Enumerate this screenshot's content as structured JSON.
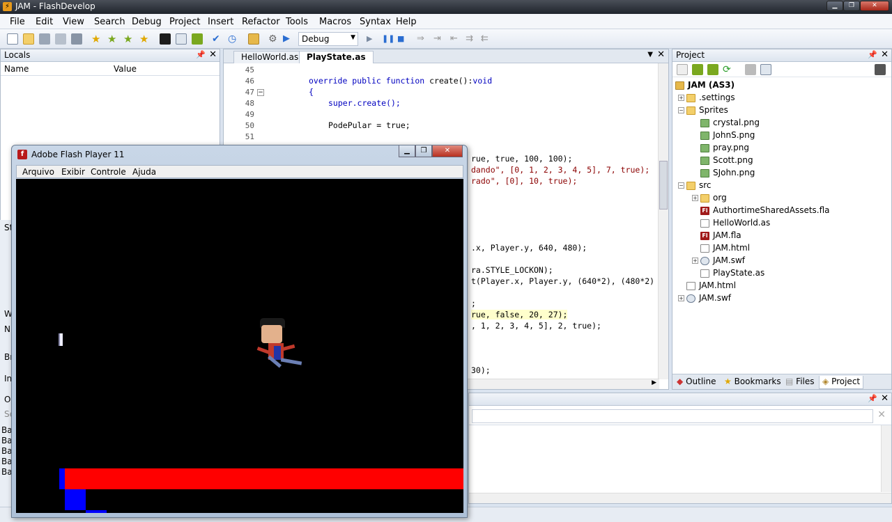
{
  "window": {
    "title": "JAM - FlashDevelop",
    "app_icon": "flashdevelop-icon"
  },
  "menu": [
    "File",
    "Edit",
    "View",
    "Search",
    "Debug",
    "Project",
    "Insert",
    "Refactor",
    "Tools",
    "Macros",
    "Syntax",
    "Help"
  ],
  "toolbar": {
    "config_value": "Debug"
  },
  "locals": {
    "title": "Locals",
    "col_name": "Name",
    "col_value": "Value"
  },
  "side_fragments": [
    "St",
    "W",
    "N",
    "Br",
    "In",
    "O"
  ],
  "editor": {
    "tabs": [
      "HelloWorld.as",
      "PlayState.as"
    ],
    "active_tab": "PlayState.as",
    "line_numbers": [
      "45",
      "46",
      "47",
      "48",
      "49",
      "50",
      "51"
    ],
    "lines": {
      "l46_kw": "override public function",
      "l46_rest": " create():",
      "l46_type": "void",
      "l47": "{",
      "l48": "super.create();",
      "l50": "PodePular = true;",
      "r1": "rue, true, 100, 100);",
      "r2": "dando\", [0, 1, 2, 3, 4, 5], 7, true);",
      "r3": "rado\", [0], 10, true);",
      "r4": ".x, Player.y, 640, 480);",
      "r5": "ra.STYLE_LOCKON);",
      "r6": "t(Player.x, Player.y, (640*2), (480*2)",
      "r7": ";",
      "r8": "rue, false, 20, 27);",
      "r9": ", 1, 2, 3, 4, 5], 2, true);",
      "r10": "30);"
    }
  },
  "project": {
    "title": "Project",
    "root": "JAM (AS3)",
    "items": [
      {
        "label": ".settings",
        "type": "folder",
        "indent": 1
      },
      {
        "label": "Sprites",
        "type": "folder",
        "indent": 1
      },
      {
        "label": "crystal.png",
        "type": "img",
        "indent": 2
      },
      {
        "label": "JohnS.png",
        "type": "img",
        "indent": 2
      },
      {
        "label": "pray.png",
        "type": "img",
        "indent": 2
      },
      {
        "label": "Scott.png",
        "type": "img",
        "indent": 2
      },
      {
        "label": "SJohn.png",
        "type": "img",
        "indent": 2
      },
      {
        "label": "src",
        "type": "folder",
        "indent": 1
      },
      {
        "label": "org",
        "type": "folder",
        "indent": 2
      },
      {
        "label": "AuthortimeSharedAssets.fla",
        "type": "fla",
        "indent": 2
      },
      {
        "label": "HelloWorld.as",
        "type": "as",
        "indent": 2
      },
      {
        "label": "JAM.fla",
        "type": "fla",
        "indent": 2
      },
      {
        "label": "JAM.html",
        "type": "as",
        "indent": 2
      },
      {
        "label": "JAM.swf",
        "type": "swf",
        "indent": 2
      },
      {
        "label": "PlayState.as",
        "type": "as",
        "indent": 2
      },
      {
        "label": "JAM.html",
        "type": "as",
        "indent": 1
      },
      {
        "label": "JAM.swf",
        "type": "swf",
        "indent": 1
      }
    ],
    "bottom_tabs": [
      "Outline",
      "Bookmarks",
      "Files",
      "Project"
    ],
    "active_bottom_tab": "Project"
  },
  "output": {
    "fragments": [
      "Ba",
      "Ba",
      "Ba",
      "Ba",
      "Ba"
    ],
    "search_prefix": "Se"
  },
  "flash": {
    "title": "Adobe Flash Player 11",
    "menu": [
      "Arquivo",
      "Exibir",
      "Controle",
      "Ajuda"
    ]
  },
  "colors": {
    "platform": "#ff0000",
    "block": "#0000ff",
    "stage": "#000000"
  }
}
